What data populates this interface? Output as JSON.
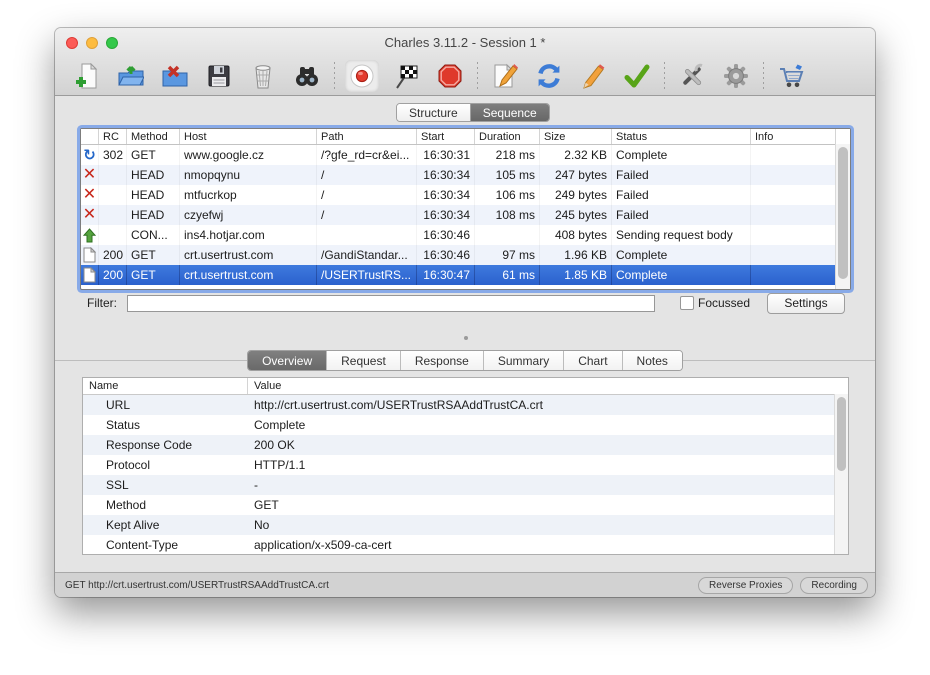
{
  "window": {
    "title": "Charles 3.11.2 - Session 1 *"
  },
  "toolbar": {
    "buttons": [
      "new-session",
      "open-session",
      "close-session",
      "save-session",
      "clear-session",
      "find",
      "record",
      "throttle",
      "breakpoints",
      "compose",
      "repeat",
      "edit",
      "validate",
      "tools",
      "settings",
      "shop"
    ],
    "active_button": "record"
  },
  "view_tabs": {
    "items": [
      "Structure",
      "Sequence"
    ],
    "selected": "Sequence"
  },
  "main_table": {
    "columns": {
      "rc": "RC",
      "method": "Method",
      "host": "Host",
      "path": "Path",
      "start": "Start",
      "duration": "Duration",
      "size": "Size",
      "status": "Status",
      "info": "Info"
    },
    "rows": [
      {
        "icon": "redirect",
        "rc": "302",
        "method": "GET",
        "host": "www.google.cz",
        "path": "/?gfe_rd=cr&ei...",
        "start": "16:30:31",
        "duration": "218 ms",
        "size": "2.32 KB",
        "status": "Complete",
        "info": ""
      },
      {
        "icon": "failed",
        "rc": "",
        "method": "HEAD",
        "host": "nmopqynu",
        "path": "/",
        "start": "16:30:34",
        "duration": "105 ms",
        "size": "247 bytes",
        "status": "Failed",
        "info": ""
      },
      {
        "icon": "failed",
        "rc": "",
        "method": "HEAD",
        "host": "mtfucrkop",
        "path": "/",
        "start": "16:30:34",
        "duration": "106 ms",
        "size": "249 bytes",
        "status": "Failed",
        "info": ""
      },
      {
        "icon": "failed",
        "rc": "",
        "method": "HEAD",
        "host": "czyefwj",
        "path": "/",
        "start": "16:30:34",
        "duration": "108 ms",
        "size": "245 bytes",
        "status": "Failed",
        "info": ""
      },
      {
        "icon": "upload",
        "rc": "",
        "method": "CON...",
        "host": "ins4.hotjar.com",
        "path": "",
        "start": "16:30:46",
        "duration": "",
        "size": "408 bytes",
        "status": "Sending request body",
        "info": ""
      },
      {
        "icon": "document",
        "rc": "200",
        "method": "GET",
        "host": "crt.usertrust.com",
        "path": "/GandiStandar...",
        "start": "16:30:46",
        "duration": "97 ms",
        "size": "1.96 KB",
        "status": "Complete",
        "info": ""
      },
      {
        "icon": "document",
        "rc": "200",
        "method": "GET",
        "host": "crt.usertrust.com",
        "path": "/USERTrustRS...",
        "start": "16:30:47",
        "duration": "61 ms",
        "size": "1.85 KB",
        "status": "Complete",
        "info": "",
        "selected": true
      }
    ]
  },
  "filter": {
    "label": "Filter:",
    "value": "",
    "focussed_label": "Focussed",
    "settings_label": "Settings"
  },
  "detail_tabs": {
    "items": [
      "Overview",
      "Request",
      "Response",
      "Summary",
      "Chart",
      "Notes"
    ],
    "selected": "Overview"
  },
  "overview_table": {
    "columns": {
      "name": "Name",
      "value": "Value"
    },
    "rows": [
      {
        "name": "URL",
        "value": "http://crt.usertrust.com/USERTrustRSAAddTrustCA.crt"
      },
      {
        "name": "Status",
        "value": "Complete"
      },
      {
        "name": "Response Code",
        "value": "200 OK"
      },
      {
        "name": "Protocol",
        "value": "HTTP/1.1"
      },
      {
        "name": "SSL",
        "value": "-"
      },
      {
        "name": "Method",
        "value": "GET"
      },
      {
        "name": "Kept Alive",
        "value": "No"
      },
      {
        "name": "Content-Type",
        "value": "application/x-x509-ca-cert"
      }
    ]
  },
  "status_bar": {
    "text": "GET http://crt.usertrust.com/USERTrustRSAAddTrustCA.crt",
    "badges": [
      "Reverse Proxies",
      "Recording"
    ]
  },
  "colors": {
    "selection": "#2e64cf",
    "focus_ring": "#7da3e8",
    "failed_red": "#c7271b",
    "record_red": "#e33b2e"
  }
}
